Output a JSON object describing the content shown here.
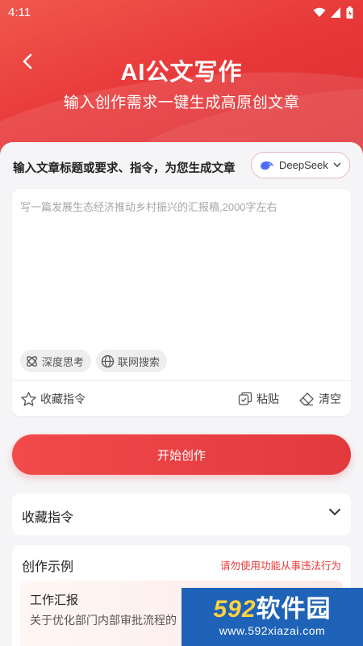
{
  "status_bar": {
    "time": "4:11"
  },
  "header": {
    "title": "AI公文写作",
    "subtitle": "输入创作需求一键生成高原创文章"
  },
  "prompt": {
    "label": "输入文章标题或要求、指令，为您生成文章",
    "model": "DeepSeek",
    "placeholder": "写一篇发展生态经济推动乡村振兴的汇报稿,2000字左右",
    "value": "",
    "chips": [
      "深度思考",
      "联网搜索"
    ],
    "actions": {
      "favorite": "收藏指令",
      "paste": "粘贴",
      "clear": "清空"
    }
  },
  "start_button": "开始创作",
  "favorites": {
    "title": "收藏指令"
  },
  "examples": {
    "title": "创作示例",
    "warning": "请勿使用功能从事违法行为",
    "items": [
      {
        "title": "工作汇报",
        "desc": "关于优化部门内部审批流程的"
      }
    ]
  },
  "watermark": {
    "brand_num": "592",
    "brand_text": "软件园",
    "url": "www.592xiazai.com"
  },
  "colors": {
    "accent": "#e8393a",
    "warning": "#e5393a",
    "watermark_bg": "#1f63b8"
  },
  "icons": [
    "back-arrow-icon",
    "wifi-icon",
    "signal-icon",
    "battery-icon",
    "deepseek-whale-icon",
    "chevron-down-icon",
    "deep-think-icon",
    "globe-icon",
    "star-icon",
    "paste-icon",
    "eraser-icon",
    "gamepad-icon"
  ]
}
